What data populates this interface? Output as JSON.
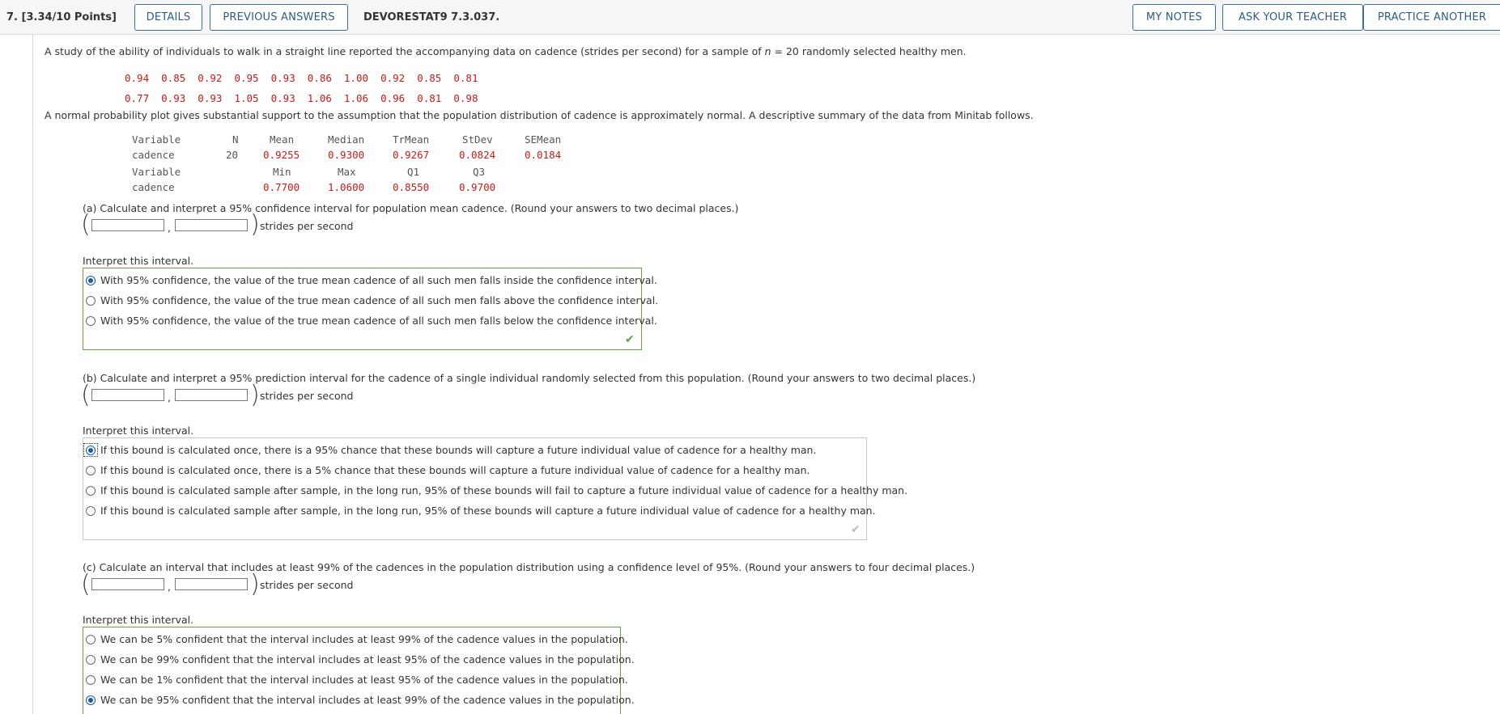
{
  "header": {
    "question_number": "7.",
    "points": "[3.34/10 Points]",
    "buttons": {
      "details": "DETAILS",
      "previous_answers": "PREVIOUS ANSWERS",
      "my_notes": "MY NOTES",
      "ask_teacher": "ASK YOUR TEACHER",
      "practice": "PRACTICE ANOTHER"
    },
    "code": "DEVORESTAT9 7.3.037."
  },
  "intro": {
    "before_n": "A study of the ability of individuals to walk in a straight line reported the accompanying data on cadence (strides per second) for a sample of ",
    "n_symbol": "n",
    "after_n": " = 20 randomly selected healthy men.",
    "data_row1": "0.94  0.85  0.92  0.95  0.93  0.86  1.00  0.92  0.85  0.81",
    "data_row2": "0.77  0.93  0.93  1.05  0.93  1.06  1.06  0.96  0.81  0.98",
    "normal_text": "A normal probability plot gives substantial support to the assumption that the population distribution of cadence is approximately normal. A descriptive summary of the data from Minitab follows."
  },
  "summary": {
    "row1_headers": {
      "variable": "Variable",
      "n": "N",
      "mean": "Mean",
      "median": "Median",
      "trmean": "TrMean",
      "stdev": "StDev",
      "semean": "SEMean"
    },
    "row1_values": {
      "variable": "cadence",
      "n": "20",
      "mean": "0.9255",
      "median": "0.9300",
      "trmean": "0.9267",
      "stdev": "0.0824",
      "semean": "0.0184"
    },
    "row2_headers": {
      "variable": "Variable",
      "min": "Min",
      "max": "Max",
      "q1": "Q1",
      "q3": "Q3"
    },
    "row2_values": {
      "variable": "cadence",
      "min": "0.7700",
      "max": "1.0600",
      "q1": "0.8550",
      "q3": "0.9700"
    }
  },
  "common": {
    "units": "strides per second",
    "interpret": "Interpret this interval.",
    "paren_open": "(",
    "paren_close": ")",
    "comma": ","
  },
  "part_a": {
    "prompt": "(a) Calculate and interpret a 95% confidence interval for population mean cadence. (Round your answers to two decimal places.)",
    "lower_value": "",
    "upper_value": "",
    "options": [
      "With 95% confidence, the value of the true mean cadence of all such men falls inside the confidence interval.",
      "With 95% confidence, the value of the true mean cadence of all such men falls above the confidence interval.",
      "With 95% confidence, the value of the true mean cadence of all such men falls below the confidence interval."
    ],
    "selected_index": 0
  },
  "part_b": {
    "prompt": "(b) Calculate and interpret a 95% prediction interval for the cadence of a single individual randomly selected from this population. (Round your answers to two decimal places.)",
    "lower_value": "",
    "upper_value": "",
    "options": [
      "If this bound is calculated once, there is a 95% chance that these bounds will capture a future individual value of cadence for a healthy man.",
      "If this bound is calculated once, there is a 5% chance that these bounds will capture a future individual value of cadence for a healthy man.",
      "If this bound is calculated sample after sample, in the long run, 95% of these bounds will fail to capture a future individual value of cadence for a healthy man.",
      "If this bound is calculated sample after sample, in the long run, 95% of these bounds will capture a future individual value of cadence for a healthy man."
    ],
    "selected_index": 0
  },
  "part_c": {
    "prompt": "(c) Calculate an interval that includes at least 99% of the cadences in the population distribution using a confidence level of 95%. (Round your answers to four decimal places.)",
    "lower_value": "",
    "upper_value": "",
    "options": [
      "We can be 5% confident that the interval includes at least 99% of the cadence values in the population.",
      "We can be 99% confident that the interval includes at least 95% of the cadence values in the population.",
      "We can be 1% confident that the interval includes at least 95% of the cadence values in the population.",
      "We can be 95% confident that the interval includes at least 99% of the cadence values in the population."
    ],
    "selected_index": 3
  },
  "colors": {
    "accent": "#2c5b87",
    "correct": "#5ba33b",
    "pending": "#bbbbbb",
    "data_red": "#c21b1b"
  },
  "icons": {
    "correct": "checkmark-icon",
    "pending": "checkmark-icon"
  }
}
